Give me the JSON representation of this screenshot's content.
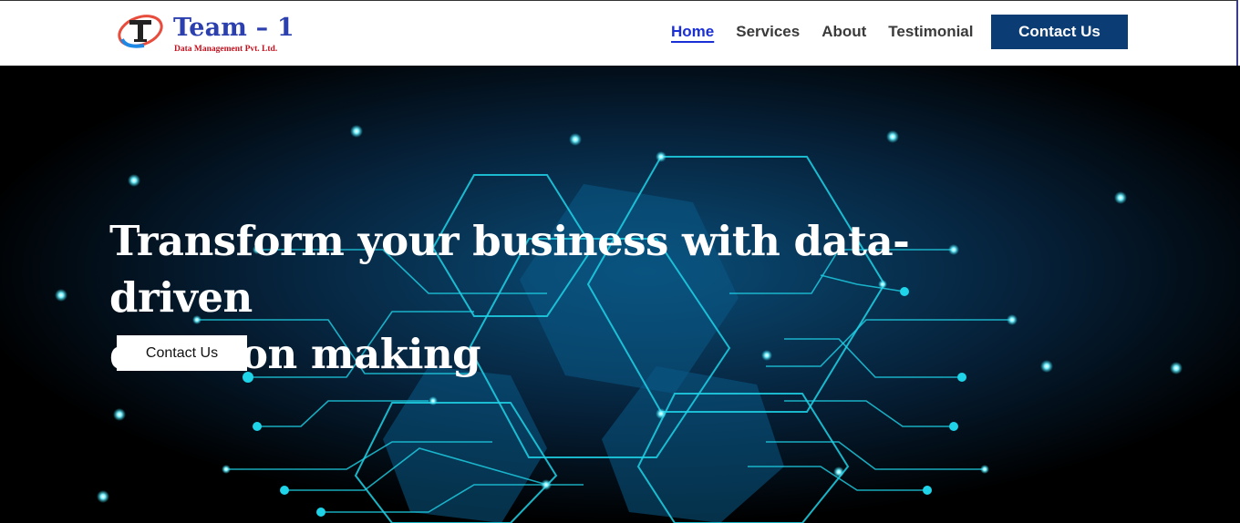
{
  "brand": {
    "name": "Team – 1",
    "tagline": "Data Management Pvt. Ltd.",
    "logo_icon": "team-one-logo-icon",
    "colors": {
      "title": "#2b3fae",
      "tagline": "#c1121f"
    }
  },
  "nav": {
    "items": [
      {
        "label": "Home",
        "active": true
      },
      {
        "label": "Services",
        "active": false
      },
      {
        "label": "About",
        "active": false
      },
      {
        "label": "Testimonial",
        "active": false
      }
    ],
    "cta_label": "Contact Us"
  },
  "hero": {
    "headline_line1": "Transform your business with data-driven",
    "headline_line2": "decision making",
    "cta_label": "Contact Us",
    "background": "hexagon-circuit-network-image"
  },
  "colors": {
    "nav_active": "#1a2fd6",
    "nav_cta_bg": "#0b3c73",
    "hero_bg": "#02060c",
    "circuit": "#1fd3e8"
  }
}
